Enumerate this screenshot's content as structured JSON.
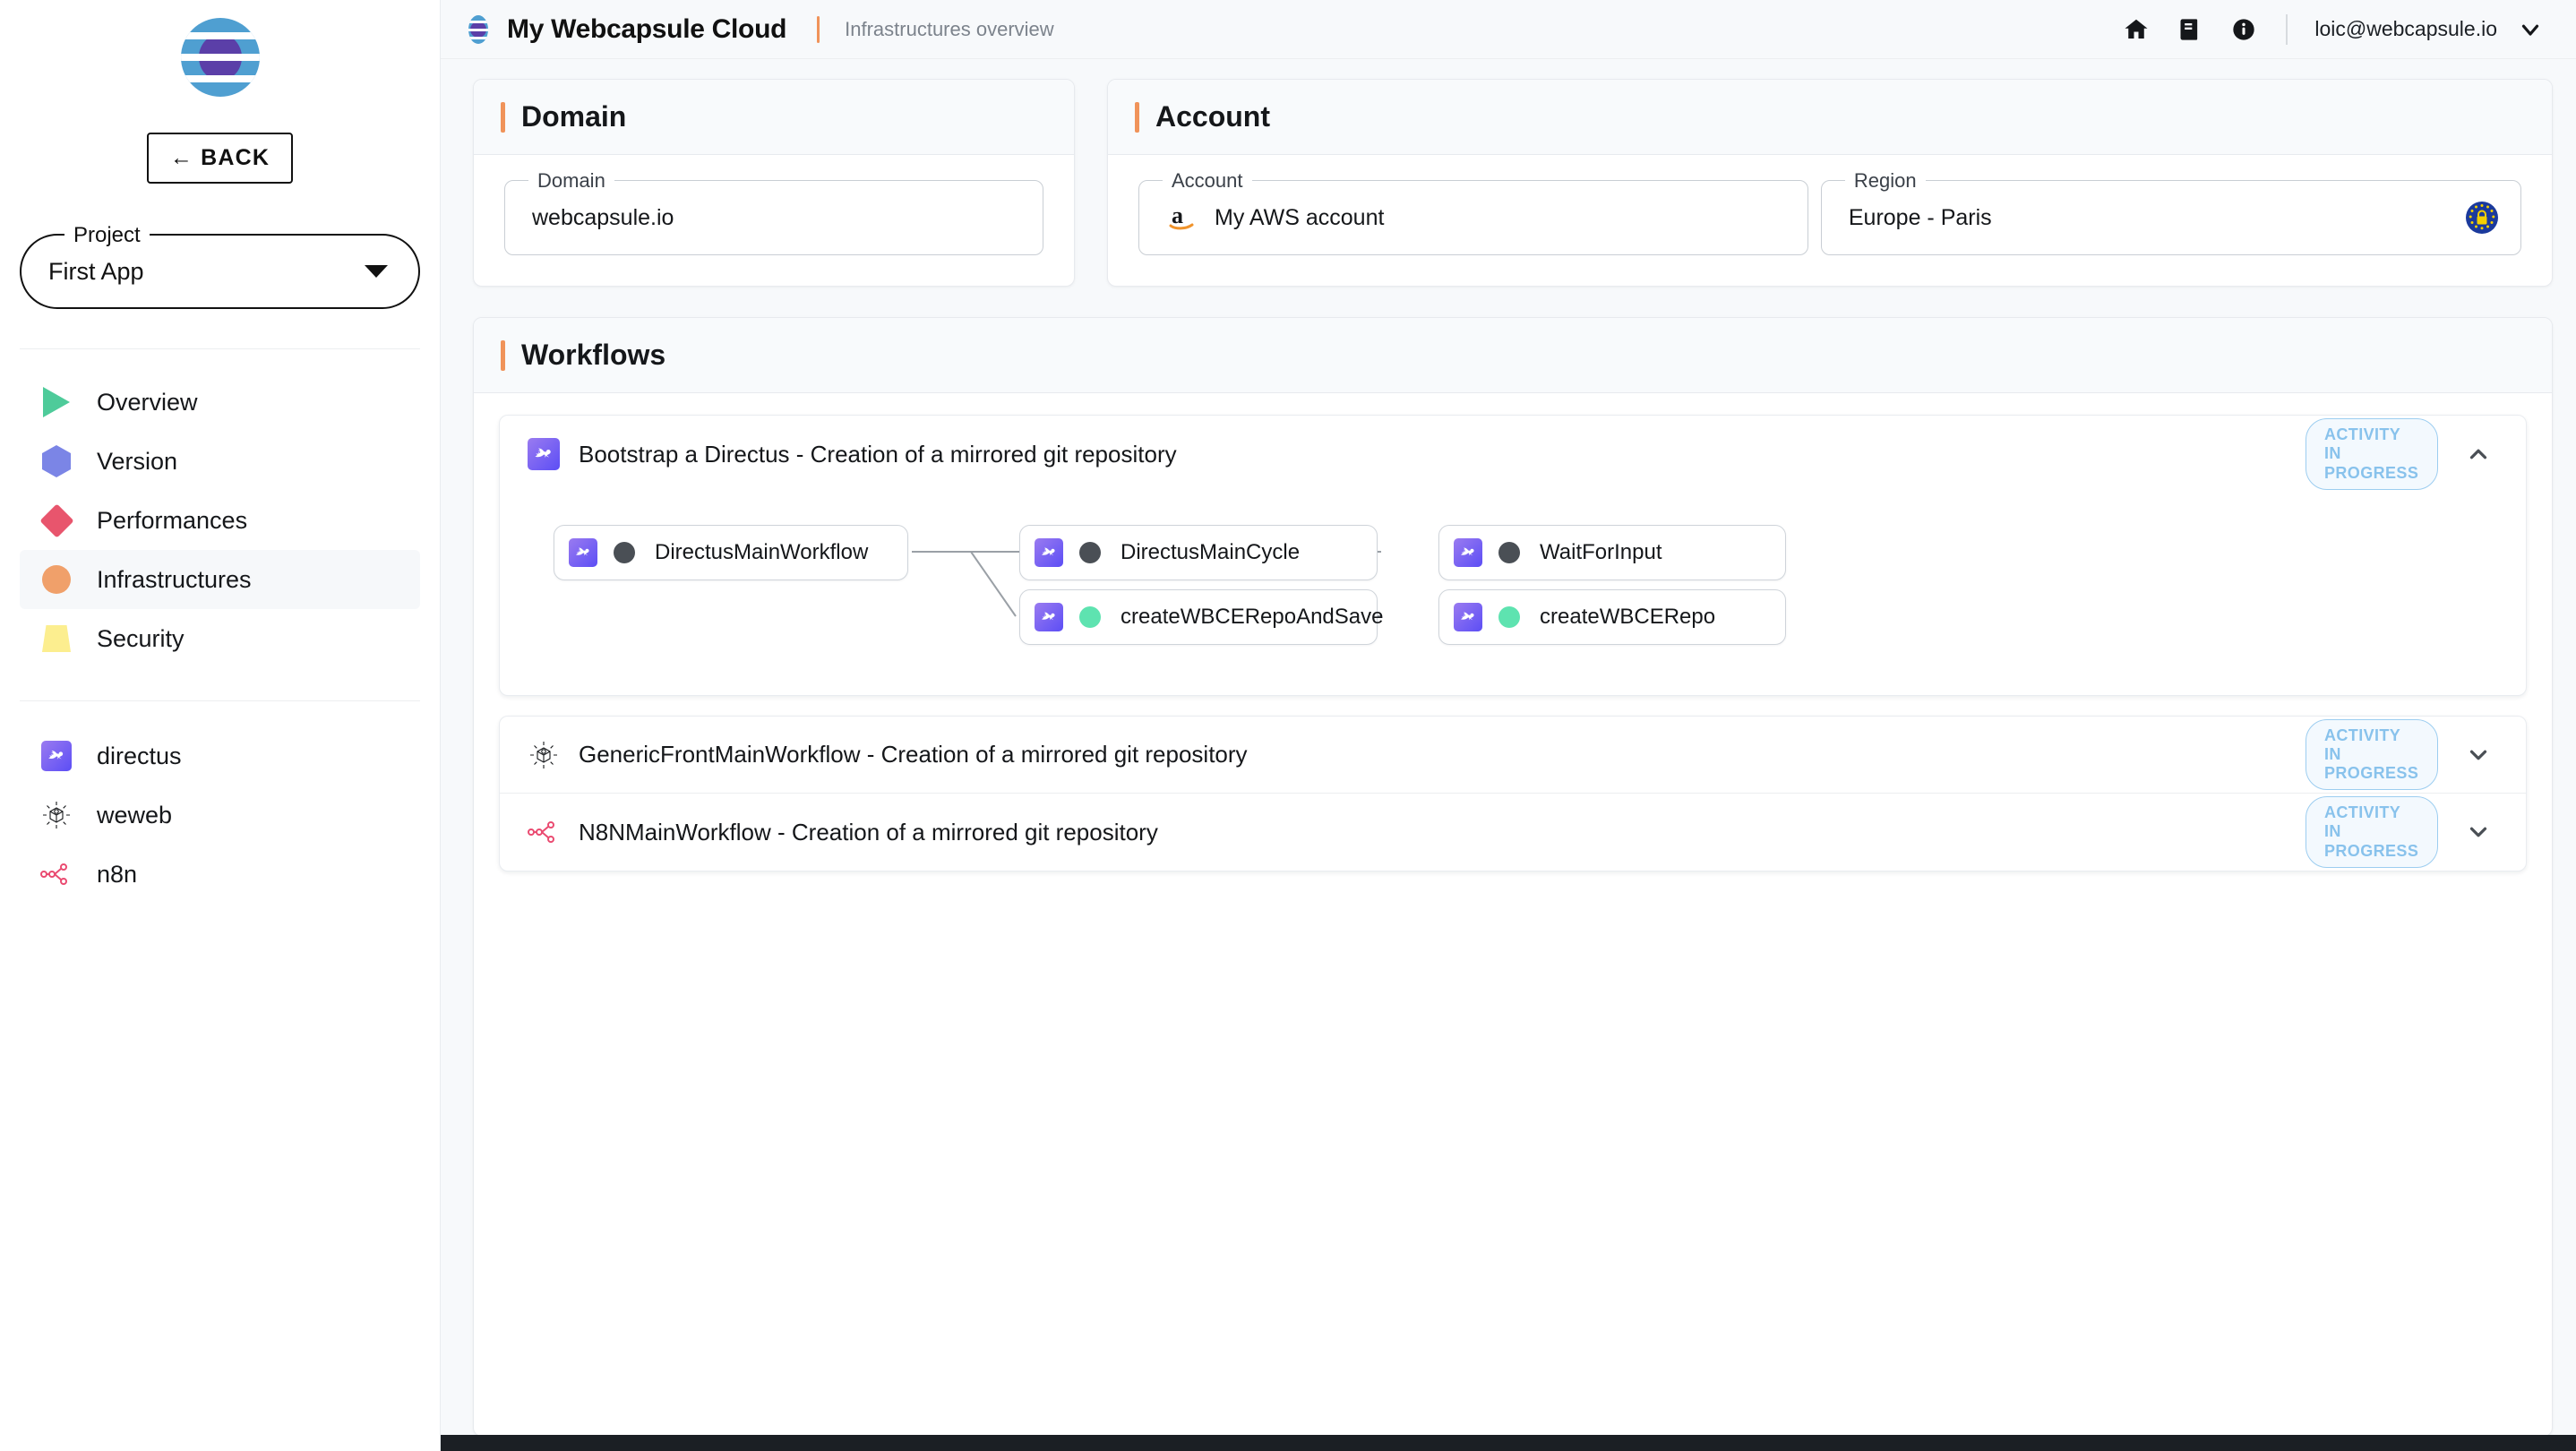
{
  "sidebar": {
    "logo_alt": "webcapsule-logo",
    "back_label": "← BACK",
    "project": {
      "legend": "Project",
      "value": "First App"
    },
    "nav_items": [
      {
        "label": "Overview",
        "icon": "triangle-icon",
        "color": "#4ecb9a",
        "active": false
      },
      {
        "label": "Version",
        "icon": "hexagon-icon",
        "color": "#7b85e6",
        "active": false
      },
      {
        "label": "Performances",
        "icon": "diamond-icon",
        "color": "#e8556d",
        "active": false
      },
      {
        "label": "Infrastructures",
        "icon": "circle-icon",
        "color": "#f0a06a",
        "active": true
      },
      {
        "label": "Security",
        "icon": "trapezoid-icon",
        "color": "#fcee8f",
        "active": false
      }
    ],
    "services": [
      {
        "label": "directus",
        "icon": "directus-icon"
      },
      {
        "label": "weweb",
        "icon": "weweb-icon"
      },
      {
        "label": "n8n",
        "icon": "n8n-icon"
      }
    ]
  },
  "topbar": {
    "title": "My Webcapsule Cloud",
    "subtitle": "Infrastructures overview",
    "icons": [
      "home-icon",
      "book-icon",
      "info-icon"
    ],
    "user_email": "loic@webcapsule.io",
    "user_caret": "chevron-down-icon"
  },
  "domain_panel": {
    "title": "Domain",
    "field": {
      "legend": "Domain",
      "value": "webcapsule.io"
    }
  },
  "account_panel": {
    "title": "Account",
    "account_field": {
      "legend": "Account",
      "value": "My AWS account",
      "icon": "amazon-icon"
    },
    "region_field": {
      "legend": "Region",
      "value": "Europe - Paris",
      "icon": "eu-gdpr-icon"
    }
  },
  "workflows_panel": {
    "title": "Workflows",
    "items": [
      {
        "title": "Bootstrap a Directus - Creation of a mirrored git repository",
        "icon": "directus-icon",
        "status": "ACTIVITY IN PROGRESS",
        "expanded": true,
        "chevron": "chevron-up-icon",
        "nodes": [
          {
            "label": "DirectusMainWorkflow",
            "state_color": "#4a4f55",
            "col": 0,
            "row": 0
          },
          {
            "label": "DirectusMainCycle",
            "state_color": "#4a4f55",
            "col": 1,
            "row": 0
          },
          {
            "label": "WaitForInput",
            "state_color": "#4a4f55",
            "col": 2,
            "row": 0
          },
          {
            "label": "createWBCERepoAndSave",
            "state_color": "#5ee3b0",
            "col": 1,
            "row": 1
          },
          {
            "label": "createWBCERepo",
            "state_color": "#5ee3b0",
            "col": 2,
            "row": 1
          }
        ]
      },
      {
        "title": "GenericFrontMainWorkflow - Creation of a mirrored git repository",
        "icon": "weweb-icon",
        "status": "ACTIVITY IN PROGRESS",
        "expanded": false,
        "chevron": "chevron-down-icon",
        "nodes": []
      },
      {
        "title": "N8NMainWorkflow - Creation of a mirrored git repository",
        "icon": "n8n-icon",
        "status": "ACTIVITY IN PROGRESS",
        "expanded": false,
        "chevron": "chevron-down-icon",
        "nodes": []
      }
    ]
  },
  "theme": {
    "accent": "#f0935a",
    "badge_border": "#9ccdf0",
    "badge_text": "#88c2ec",
    "bg": "#f7f9fb"
  }
}
